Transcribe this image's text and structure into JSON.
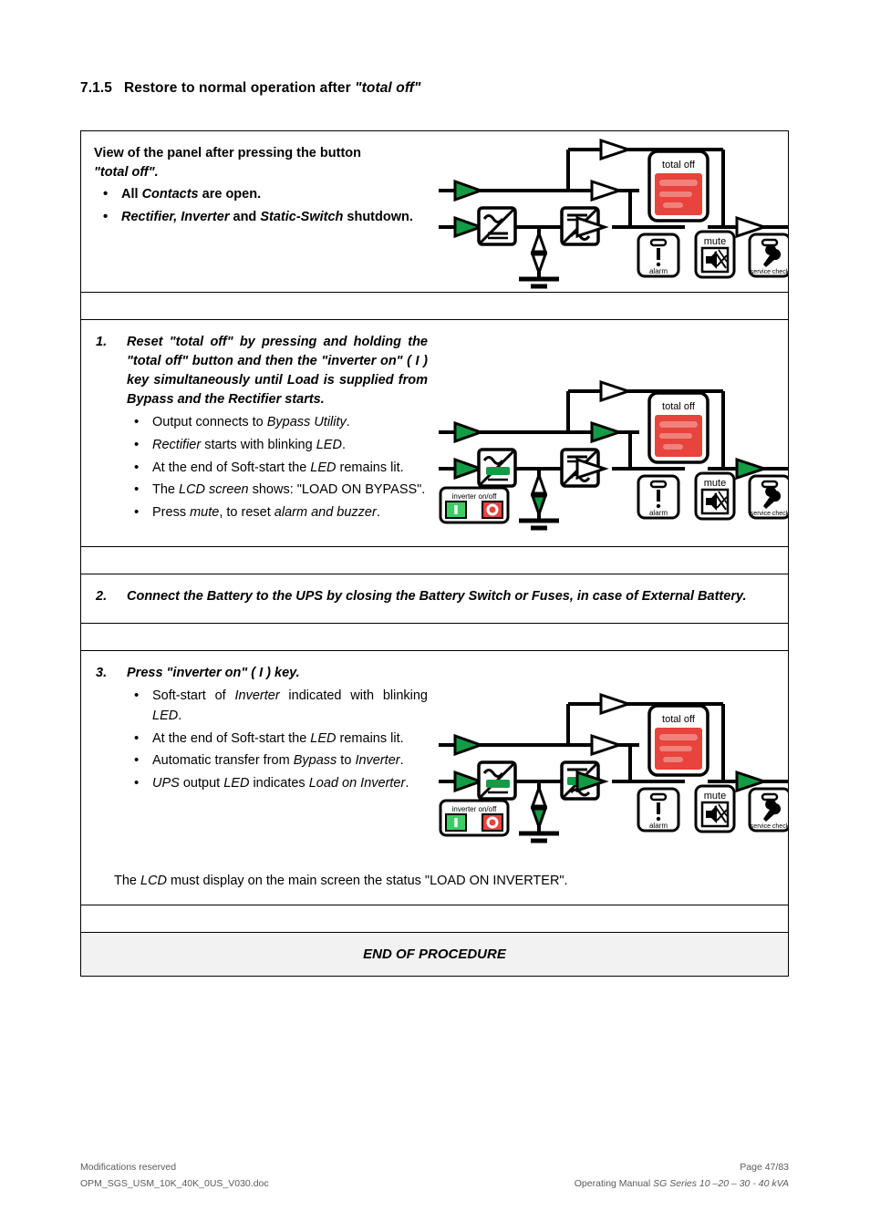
{
  "heading": {
    "number": "7.1.5",
    "text_before": "Restore to normal operation after ",
    "text_italic": "\"total off\""
  },
  "table": {
    "row_intro": {
      "lead_line1": "View of the panel after pressing the button",
      "lead_line2": "\"total off\".",
      "bullets": [
        {
          "pre": "All ",
          "ital": "Contacts",
          "post": " are open."
        },
        {
          "pre": "",
          "ital": "Rectifier, Inverter",
          "mid": " and ",
          "ital2": "Static-Switch",
          "post": " shutdown."
        }
      ]
    },
    "row_step1": {
      "number": "1.",
      "header": "Reset \"total off\" by pressing and holding the \"total off\" button and then the \"inverter on\" ( I ) key simultaneously until Load is supplied from Bypass and the Rectifier starts.",
      "bullets": [
        "Output connects to Bypass Utility.",
        "Rectifier starts with blinking LED.",
        "At the end of Soft-start the LED remains lit.",
        "The LCD screen shows: \"LOAD ON BYPASS\".",
        "Press mute, to reset alarm and buzzer."
      ]
    },
    "row_step2": {
      "number": "2.",
      "text": "Connect the Battery to the UPS by closing the Battery Switch or Fuses, in case of External Battery."
    },
    "row_step3": {
      "number": "3.",
      "header": "Press \"inverter on\" ( I ) key.",
      "bullets": [
        "Soft-start of Inverter indicated with blinking LED.",
        "At the end of Soft-start the LED remains lit.",
        "Automatic transfer from Bypass to Inverter.",
        "UPS output LED indicates Load on Inverter."
      ],
      "closing": "The LCD must display on the main screen the status \"LOAD ON INVERTER\"."
    },
    "row_end": {
      "label": "END OF PROCEDURE"
    }
  },
  "diagrams": {
    "labels": {
      "total_off": "total off",
      "alarm": "alarm",
      "mute": "mute",
      "service_check": "service check",
      "inverter_onoff": "inverter on/off",
      "inverter_on_key": "I",
      "inverter_off_key": "O"
    },
    "colors": {
      "green": "#149b46",
      "red": "#e8433c",
      "red_bar": "#f0827c",
      "black": "#000000",
      "white": "#ffffff"
    },
    "panel1": {
      "name": "panel-after-total-off",
      "states": {
        "input_arrow_bypass": "green",
        "input_arrow_main": "green",
        "rectifier_block": "off",
        "inverter_block": "off",
        "battery_symbol": "off",
        "static_switch_arrow": "off",
        "bypass_top_arrow": "off",
        "bypass_mid_arrow": "off",
        "output_arrow": "off",
        "total_off_button": "active-red",
        "inverter_onoff_panel": "hidden"
      }
    },
    "panel2": {
      "name": "panel-load-on-bypass",
      "states": {
        "input_arrow_bypass": "green",
        "input_arrow_main": "green",
        "rectifier_block": "green",
        "inverter_block": "off",
        "battery_symbol": "green",
        "static_switch_arrow": "off",
        "bypass_top_arrow": "off",
        "bypass_mid_arrow": "green",
        "output_arrow": "green",
        "total_off_button": "active-red",
        "inverter_onoff_panel": "visible"
      }
    },
    "panel3": {
      "name": "panel-load-on-inverter",
      "states": {
        "input_arrow_bypass": "green",
        "input_arrow_main": "green",
        "rectifier_block": "green",
        "inverter_block": "green",
        "battery_symbol": "green",
        "static_switch_arrow": "green",
        "bypass_top_arrow": "off",
        "bypass_mid_arrow": "off",
        "output_arrow": "green",
        "total_off_button": "active-red",
        "inverter_onoff_panel": "visible"
      }
    }
  },
  "footer": {
    "left_line1": "Modifications reserved",
    "left_line2": "OPM_SGS_USM_10K_40K_0US_V030.doc",
    "right_line1": "Page 47/83",
    "right_line2_plain": "Operating Manual ",
    "right_line2_italic": "SG Series 10 –20 – 30 - 40 kVA"
  }
}
